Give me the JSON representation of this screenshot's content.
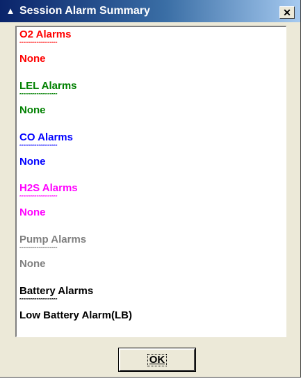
{
  "window": {
    "title": "Session Alarm Summary",
    "close_glyph": "✕",
    "title_icon": "alarm-bell-icon"
  },
  "colors": {
    "o2": "#ff0000",
    "lel": "#008000",
    "co": "#0000ff",
    "h2s": "#ff00ff",
    "pump": "#808080",
    "battery": "#000000"
  },
  "alarms": [
    {
      "id": "o2",
      "header": "O2  Alarms",
      "rule": "********************",
      "value": "None"
    },
    {
      "id": "lel",
      "header": "LEL  Alarms",
      "rule": "********************",
      "value": "None"
    },
    {
      "id": "co",
      "header": "CO  Alarms",
      "rule": "********************",
      "value": "None"
    },
    {
      "id": "h2s",
      "header": "H2S  Alarms",
      "rule": "********************",
      "value": "None"
    },
    {
      "id": "pump",
      "header": "Pump Alarms",
      "rule": "********************",
      "value": "None"
    },
    {
      "id": "battery",
      "header": "Battery Alarms",
      "rule": "********************",
      "value": "Low Battery Alarm(LB)"
    }
  ],
  "buttons": {
    "ok_label": "OK"
  }
}
